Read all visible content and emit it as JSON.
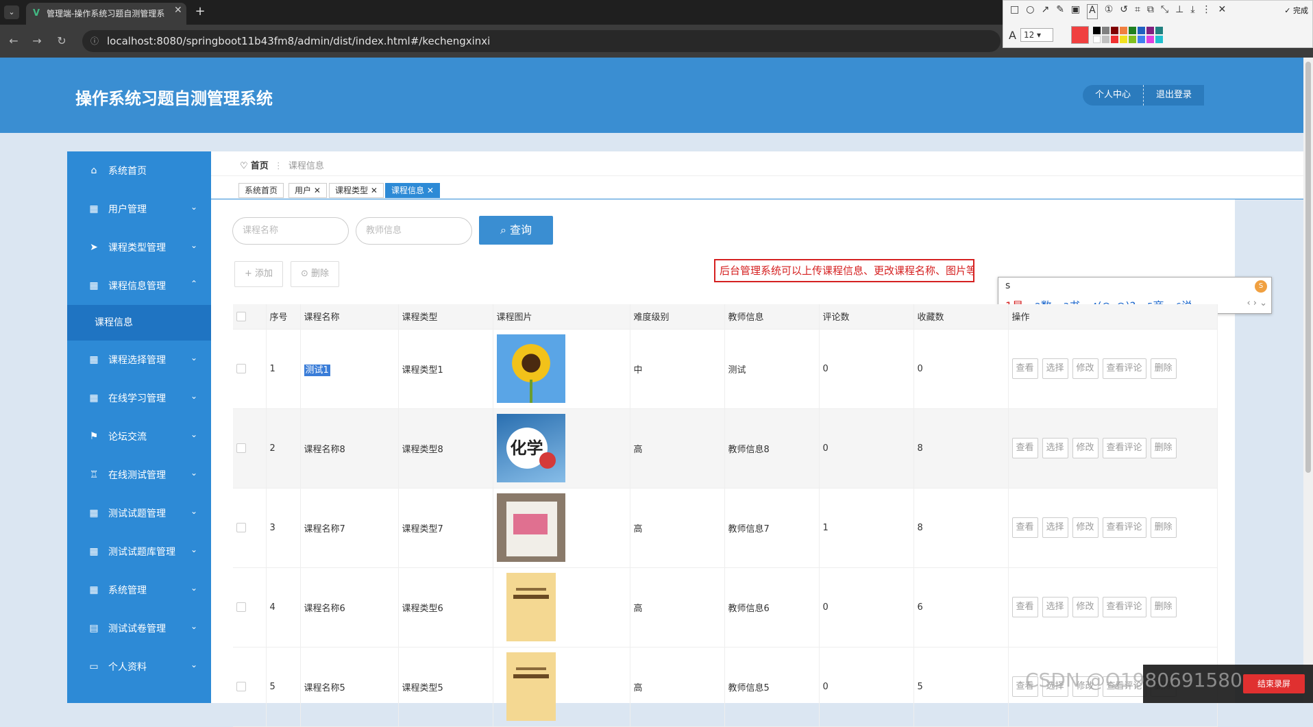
{
  "browser": {
    "tab_title": "管理端-操作系统习题自测管理系",
    "url": "localhost:8080/springboot11b43fm8/admin/dist/index.html#/kechengxinxi",
    "snip_done": "完成",
    "snip_font_size": "12"
  },
  "header": {
    "title": "操作系统习题自测管理系统",
    "personal_center": "个人中心",
    "logout": "退出登录"
  },
  "sidebar": {
    "items": [
      {
        "label": "系统首页",
        "icon": "home-icon"
      },
      {
        "label": "用户管理",
        "icon": "grid-icon"
      },
      {
        "label": "课程类型管理",
        "icon": "send-icon"
      },
      {
        "label": "课程信息管理",
        "icon": "grid-icon"
      },
      {
        "label": "课程选择管理",
        "icon": "grid-icon"
      },
      {
        "label": "在线学习管理",
        "icon": "grid-icon"
      },
      {
        "label": "论坛交流",
        "icon": "flag-icon"
      },
      {
        "label": "在线测试管理",
        "icon": "cup-icon"
      },
      {
        "label": "测试试题管理",
        "icon": "grid-icon"
      },
      {
        "label": "测试试题库管理",
        "icon": "grid-icon"
      },
      {
        "label": "系统管理",
        "icon": "grid-icon"
      },
      {
        "label": "测试试卷管理",
        "icon": "file-icon"
      },
      {
        "label": "个人资料",
        "icon": "card-icon"
      }
    ],
    "sub_item": "课程信息"
  },
  "breadcrumb": {
    "home": "首页",
    "current": "课程信息"
  },
  "tags": [
    "系统首页",
    "用户",
    "课程类型",
    "课程信息"
  ],
  "search": {
    "course_name_placeholder": "课程名称",
    "teacher_placeholder": "教师信息",
    "query_button": "查询"
  },
  "toolbar": {
    "add": "添加",
    "delete": "删除"
  },
  "annotation": "后台管理系统可以上传课程信息、更改课程名称、图片等",
  "ime": {
    "input": "s",
    "candidates": [
      {
        "n": "1",
        "w": "是"
      },
      {
        "n": "2",
        "w": "数"
      },
      {
        "n": "3",
        "w": "书"
      },
      {
        "n": "4",
        "w": "(⊙_⊙)?"
      },
      {
        "n": "5",
        "w": "商"
      },
      {
        "n": "6",
        "w": "说"
      }
    ]
  },
  "table": {
    "columns": [
      "序号",
      "课程名称",
      "课程类型",
      "课程图片",
      "难度级别",
      "教师信息",
      "评论数",
      "收藏数",
      "操作"
    ],
    "rows": [
      {
        "no": "1",
        "name": "测试1",
        "type": "课程类型1",
        "image": "sunflower",
        "level": "中",
        "teacher": "测试",
        "comments": "0",
        "favorites": "0"
      },
      {
        "no": "2",
        "name": "课程名称8",
        "type": "课程类型8",
        "image": "chemistry",
        "level": "高",
        "teacher": "教师信息8",
        "comments": "0",
        "favorites": "8"
      },
      {
        "no": "3",
        "name": "课程名称7",
        "type": "课程类型7",
        "image": "book",
        "level": "高",
        "teacher": "教师信息7",
        "comments": "1",
        "favorites": "8"
      },
      {
        "no": "4",
        "name": "课程名称6",
        "type": "课程类型6",
        "image": "yellow-book",
        "level": "高",
        "teacher": "教师信息6",
        "comments": "0",
        "favorites": "6"
      },
      {
        "no": "5",
        "name": "课程名称5",
        "type": "课程类型5",
        "image": "yellow-book",
        "level": "高",
        "teacher": "教师信息5",
        "comments": "0",
        "favorites": "5"
      }
    ],
    "actions": [
      "查看",
      "选择",
      "修改",
      "查看评论",
      "删除"
    ]
  },
  "watermark": "CSDN @Q1980691580",
  "watermark_badge": "结束录屏",
  "colors": {
    "primary": "#3a8ed2",
    "sidebar": "#2d8ad6",
    "annotation": "#d52020"
  }
}
